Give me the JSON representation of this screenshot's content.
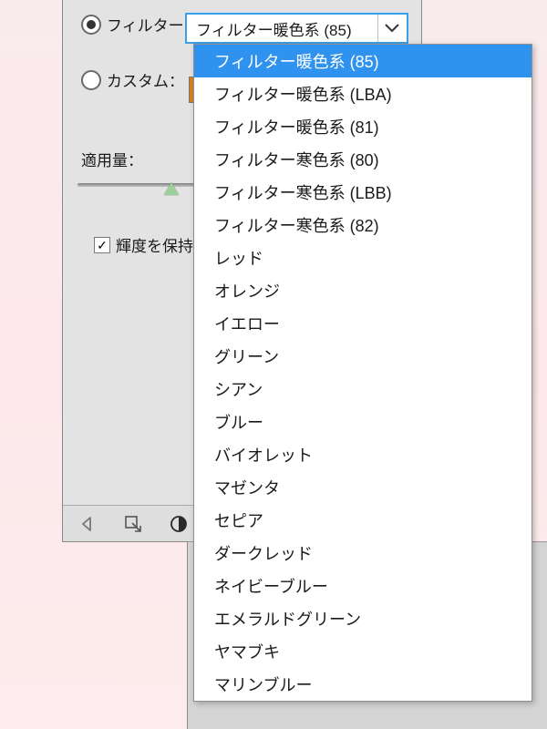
{
  "filter": {
    "label": "フィルター：",
    "selected": "フィルター暖色系 (85)",
    "options": [
      "フィルター暖色系 (85)",
      "フィルター暖色系 (LBA)",
      "フィルター暖色系 (81)",
      "フィルター寒色系 (80)",
      "フィルター寒色系 (LBB)",
      "フィルター寒色系 (82)",
      "レッド",
      "オレンジ",
      "イエロー",
      "グリーン",
      "シアン",
      "ブルー",
      "バイオレット",
      "マゼンタ",
      "セピア",
      "ダークレッド",
      "ネイビーブルー",
      "エメラルドグリーン",
      "ヤマブキ",
      "マリンブルー"
    ]
  },
  "custom": {
    "label": "カスタム：",
    "swatch_color": "#d5831e"
  },
  "density": {
    "label": "適用量："
  },
  "preserve_luminosity": {
    "label": "輝度を保持",
    "checked": true
  },
  "highlight_index": 0
}
